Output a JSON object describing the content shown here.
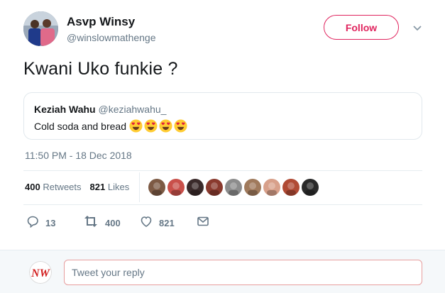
{
  "author": {
    "display_name": "Asvp Winsy",
    "handle": "@winslowmathenge"
  },
  "follow_button": {
    "label": "Follow"
  },
  "tweet": {
    "text": "Kwani Uko funkie ?",
    "timestamp": "11:50 PM - 18 Dec 2018"
  },
  "quoted_tweet": {
    "name": "Keziah Wahu",
    "handle": "@keziahwahu_",
    "text": "Cold soda and bread",
    "emojis": [
      "heart-eyes-emoji",
      "heart-eyes-emoji",
      "heart-eyes-emoji",
      "heart-eyes-emoji"
    ]
  },
  "stats": {
    "retweets_count": "400",
    "retweets_label": "Retweets",
    "likes_count": "821",
    "likes_label": "Likes"
  },
  "likers": [
    {
      "color": "#7d5a44"
    },
    {
      "color": "#c9504a"
    },
    {
      "color": "#3a2a2a"
    },
    {
      "color": "#8a3a2e"
    },
    {
      "color": "#8c8c8c"
    },
    {
      "color": "#a07a5c"
    },
    {
      "color": "#d8a08a"
    },
    {
      "color": "#b04a34"
    },
    {
      "color": "#2a2a2a"
    }
  ],
  "actions": {
    "reply_count": "13",
    "retweet_count": "400",
    "like_count": "821"
  },
  "reply": {
    "placeholder": "Tweet your reply",
    "avatar_text": "NW"
  },
  "colors": {
    "brand_pink": "#e0245e",
    "muted": "#657786",
    "icon": "#657786"
  }
}
